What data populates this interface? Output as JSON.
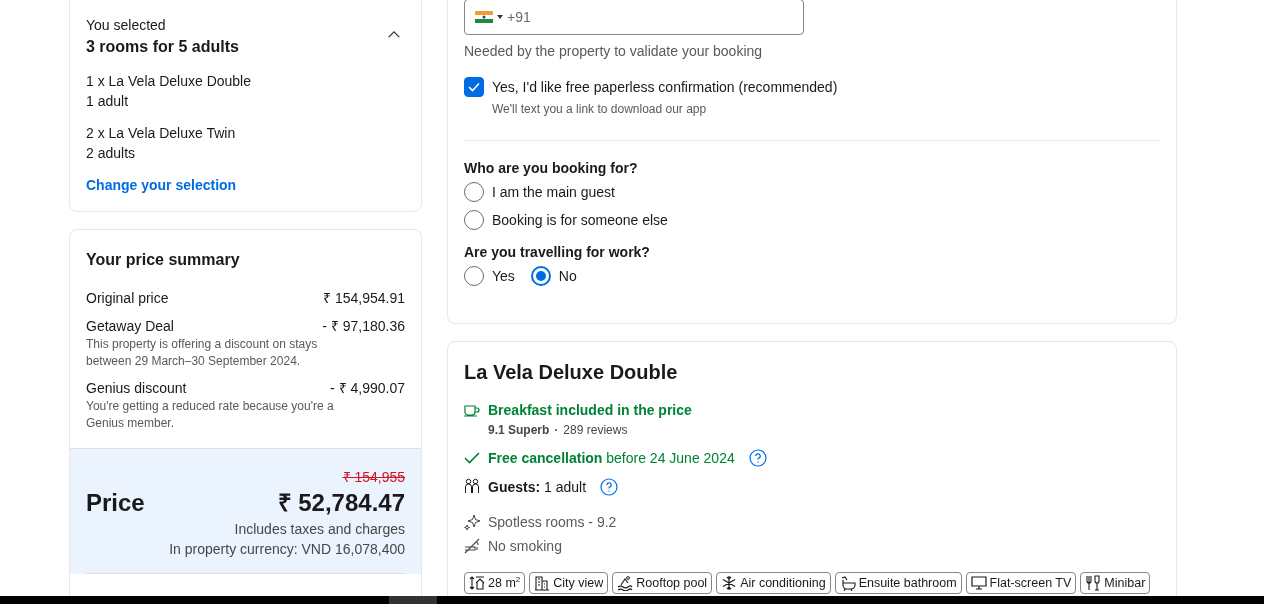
{
  "selection": {
    "label": "You selected",
    "title": "3 rooms for 5 adults",
    "expanded": true,
    "rooms": [
      {
        "name": "1 x La Vela Deluxe Double",
        "guests": "1 adult"
      },
      {
        "name": "2 x La Vela Deluxe Twin",
        "guests": "2 adults"
      }
    ],
    "change_link": "Change your selection"
  },
  "price_summary": {
    "title": "Your price summary",
    "lines": [
      {
        "label": "Original price",
        "amount": "₹ 154,954.91"
      },
      {
        "label": "Getaway Deal",
        "amount": "- ₹ 97,180.36",
        "note": "This property is offering a discount on stays between 29 March–30 September 2024."
      },
      {
        "label": "Genius discount",
        "amount": "- ₹ 4,990.07",
        "note": "You're getting a reduced rate because you're a Genius member."
      }
    ],
    "total": {
      "label": "Price",
      "old_price": "₹ 154,955",
      "price": "₹ 52,784.47",
      "note": "Includes taxes and charges",
      "currency_note": "In property currency: VND 16,078,400"
    }
  },
  "contact": {
    "phone": {
      "prefix": "+91",
      "hint": "Needed by the property to validate your booking"
    },
    "paperless": {
      "label": "Yes, I'd like free paperless confirmation (recommended)",
      "checked": true,
      "note": "We'll text you a link to download our app"
    },
    "questions": [
      {
        "title": "Who are you booking for?",
        "kind": "stacked",
        "options": [
          {
            "label": "I am the main guest",
            "selected": false
          },
          {
            "label": "Booking is for someone else",
            "selected": false
          }
        ]
      },
      {
        "title": "Are you travelling for work?",
        "kind": "inline",
        "options": [
          {
            "label": "Yes",
            "selected": false
          },
          {
            "label": "No",
            "selected": true
          }
        ]
      }
    ]
  },
  "room": {
    "name": "La Vela Deluxe Double",
    "breakfast": "Breakfast included in the price",
    "rating": "9.1 Superb",
    "reviews": "289 reviews",
    "cancellation": "**Free cancellation** before 24 June 2024",
    "guests": "**Guests:** 1 adult",
    "highlights": [
      {
        "kind": "sparkle",
        "text": "Spotless rooms - 9.2"
      },
      {
        "kind": "no-smoking",
        "text": "No smoking"
      }
    ],
    "facilities": [
      {
        "kind": "size",
        "label": "28 m$^{2}$"
      },
      {
        "kind": "city",
        "label": "City view"
      },
      {
        "kind": "pool",
        "label": "Rooftop pool"
      },
      {
        "kind": "snow",
        "label": "Air conditioning"
      },
      {
        "kind": "bath",
        "label": "Ensuite bathroom"
      },
      {
        "kind": "tv",
        "label": "Flat-screen TV"
      },
      {
        "kind": "minibar",
        "label": "Minibar"
      }
    ]
  }
}
